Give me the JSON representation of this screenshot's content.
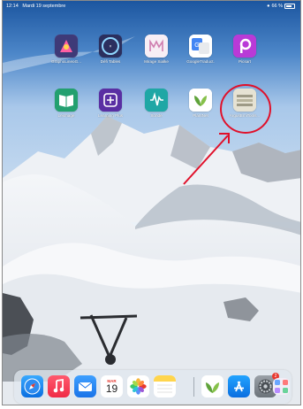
{
  "status_bar": {
    "time": "12:14",
    "date": "Mardi 19 septembre",
    "battery": "66 %"
  },
  "apps_row1": [
    {
      "label": "GraphoLineoG...",
      "icon": "graphoLineo-icon",
      "color": "#d24f8c"
    },
    {
      "label": "Défi Tables",
      "icon": "defi-tables-icon",
      "color": "#2b2f5e"
    },
    {
      "label": "Mirage Sialke",
      "icon": "mirage-icon",
      "color": "#f5f0f5"
    },
    {
      "label": "GoogleTraduct.",
      "icon": "google-translate-icon",
      "color": "#ffffff"
    },
    {
      "label": "Picsart",
      "icon": "picsart-icon",
      "color": "#b93ad7"
    }
  ],
  "apps_row2": [
    {
      "label": "Lexmage",
      "icon": "lexmage-icon",
      "color": "#23a06f"
    },
    {
      "label": "Learning Plus",
      "icon": "learning-plus-icon",
      "color": "#5a2fa3"
    },
    {
      "label": "Sonde",
      "icon": "sonde-icon",
      "color": "#1fa7a5"
    },
    {
      "label": "PlantNet",
      "icon": "plantnet-icon",
      "color": "#ffffff"
    },
    {
      "label": "ArgusEmiTools...",
      "icon": "argus-tool-icon",
      "color": "#d9d4c2"
    }
  ],
  "dock": {
    "calendar": {
      "day": "MAR",
      "date": "19"
    },
    "settings_badge": "2"
  },
  "annotation": {
    "color": "#e0102a"
  }
}
